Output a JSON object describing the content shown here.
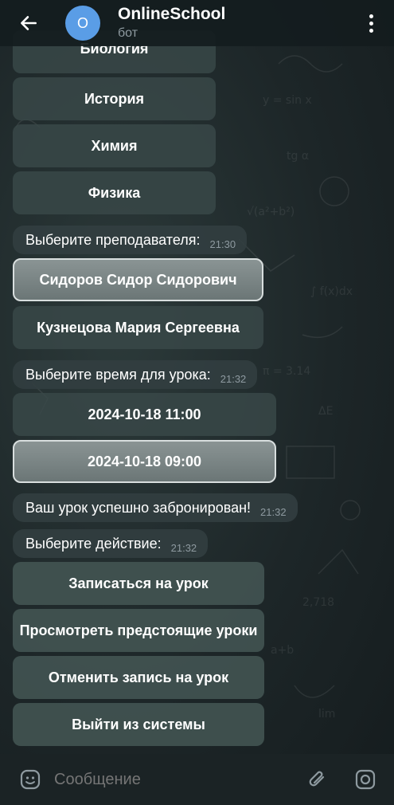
{
  "header": {
    "back_icon": "arrow-left-icon",
    "avatar_letter": "O",
    "title": "OnlineSchool",
    "subtitle": "бот",
    "menu_icon": "more-vertical-icon"
  },
  "subjects": [
    "Биология",
    "История",
    "Химия",
    "Физика"
  ],
  "messages": {
    "choose_teacher": {
      "text": "Выберите преподавателя:",
      "time": "21:30"
    },
    "choose_time": {
      "text": "Выберите время для урока:",
      "time": "21:32"
    },
    "booked": {
      "text": "Ваш урок успешно забронирован!",
      "time": "21:32"
    },
    "choose_action": {
      "text": "Выберите действие:",
      "time": "21:32"
    }
  },
  "teachers": [
    "Сидоров Сидор Сидорович",
    "Кузнецова Мария Сергеевна"
  ],
  "times": [
    "2024-10-18 11:00",
    "2024-10-18 09:00"
  ],
  "actions": [
    "Записаться на урок",
    "Просмотреть предстоящие уроки",
    "Отменить запись на урок",
    "Выйти из системы"
  ],
  "input": {
    "placeholder": "Сообщение",
    "emoji_icon": "emoji-icon",
    "attach_icon": "paperclip-icon",
    "camera_icon": "camera-icon"
  },
  "colors": {
    "avatar": "#5a9de6",
    "button": "#384848",
    "selected_button": "#7a8686"
  }
}
